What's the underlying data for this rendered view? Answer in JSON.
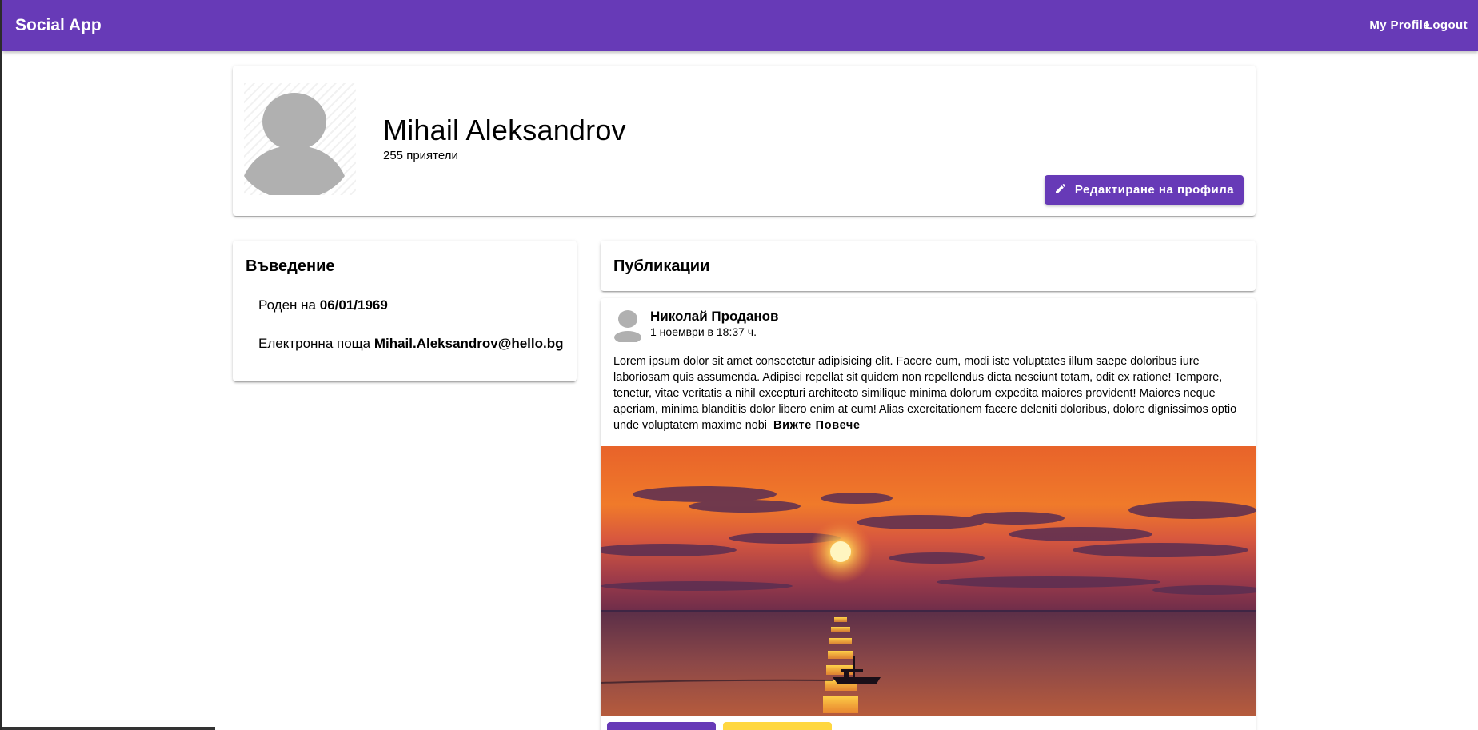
{
  "app": {
    "title": "Social App"
  },
  "nav": {
    "profile_label": "My Profile",
    "logout_label": "Logout"
  },
  "profile": {
    "name": "Mihail Aleksandrov",
    "friends": "255 приятели",
    "edit_label": "Редактиране на профила",
    "edit_icon": "pencil-icon"
  },
  "intro": {
    "title": "Въведение",
    "birth_label": "Роден на",
    "birth_value": "06/01/1969",
    "email_label": "Електронна поща",
    "email_value": "Mihail.Aleksandrov@hello.bg"
  },
  "posts": {
    "title": "Публикации",
    "items": [
      {
        "author": "Николай Проданов",
        "time": "1 ноември в 18:37 ч.",
        "text": "Lorem ipsum dolor sit amet consectetur adipisicing elit. Facere eum, modi iste voluptates illum saepe doloribus iure laboriosam quis assumenda. Adipisci repellat sit quidem non repellendus dicta nesciunt totam, odit ex ratione! Tempore, tenetur, vitae veritatis a nihil excepturi architecto similique minima dolorum expedita maiores provident! Maiores neque aperiam, minima blanditiis dolor libero enim at eum! Alias exercitationem facere deleniti doloribus, dolore dignissimos optio unde voluptatem maxime nobi",
        "see_more": "Вижте Повече"
      }
    ]
  },
  "colors": {
    "primary": "#673ab7",
    "accent": "#ffd740",
    "avatar_gray": "#b0b0b0"
  }
}
